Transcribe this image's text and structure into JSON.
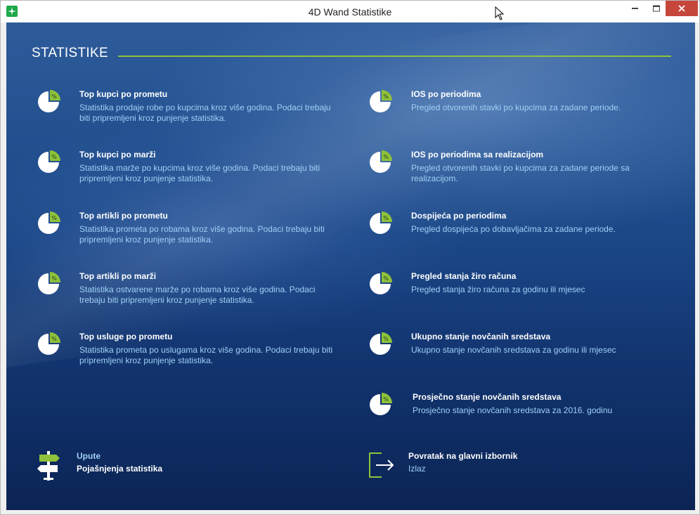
{
  "window": {
    "title": "4D Wand Statistike",
    "controls": [
      "minimize",
      "maximize",
      "close"
    ]
  },
  "page": {
    "heading": "STATISTIKE"
  },
  "left_items": [
    {
      "title": "Top kupci po prometu",
      "desc": "Statistika prodaje robe po kupcima kroz više godina. Podaci trebaju biti pripremljeni kroz punjenje statistika."
    },
    {
      "title": "Top kupci po marži",
      "desc": "Statistika marže po kupcima kroz više godina. Podaci trebaju biti pripremljeni kroz punjenje statistika."
    },
    {
      "title": "Top artikli po prometu",
      "desc": "Statistika prometa po robama kroz više godina. Podaci trebaju biti pripremljeni kroz punjenje statistika."
    },
    {
      "title": "Top artikli po marži",
      "desc": "Statistika ostvarene marže po robama kroz više godina. Podaci trebaju biti pripremljeni kroz punjenje statistika."
    },
    {
      "title": "Top usluge po prometu",
      "desc": "Statistika prometa po uslugama kroz više godina. Podaci trebaju biti pripremljeni kroz punjenje statistika."
    }
  ],
  "right_items": [
    {
      "title": "IOS po periodima",
      "desc": "Pregled otvorenih stavki po kupcima za zadane periode."
    },
    {
      "title": "IOS po periodima sa realizacijom",
      "desc": "Pregled otvorenih stavki po kupcima za zadane periode sa realizacijom."
    },
    {
      "title": "Dospijeća po periodima",
      "desc": "Pregled dospijeća po dobavljačima za zadane periode."
    },
    {
      "title": "Pregled stanja žiro računa",
      "desc": "Pregled stanja žiro računa za godinu ili mjesec"
    },
    {
      "title": "Ukupno stanje novčanih sredstava",
      "desc": "Ukupno stanje novčanih sredstava za godinu ili mjesec"
    },
    {
      "title": "Prosječno stanje novčanih sredstava",
      "desc": "Prosječno stanje novčanih sredstava za 2016. godinu"
    }
  ],
  "footer": {
    "help": {
      "title": "Upute",
      "subtitle": "Pojašnjenja statistika"
    },
    "exit": {
      "title": "Povratak na glavni izbornik",
      "subtitle": "Izlaz"
    }
  },
  "icons": {
    "stat": "pie-chart-percent-icon",
    "help": "signpost-icon",
    "exit": "exit-arrow-icon",
    "app": "app-icon"
  },
  "colors": {
    "accent_green": "#8fc23a",
    "title_text": "#ffffff",
    "desc_text": "#9fd0f5",
    "footer_title_help": "#9fd0f5",
    "close_button": "#c7463c"
  }
}
